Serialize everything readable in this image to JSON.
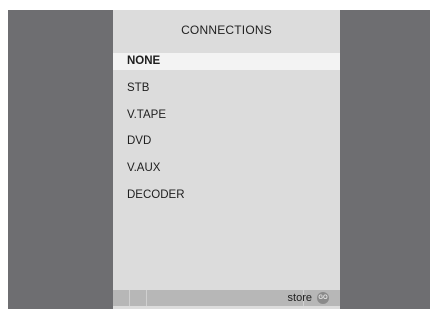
{
  "menu": {
    "title": "CONNECTIONS",
    "items": [
      {
        "label": "NONE",
        "selected": true
      },
      {
        "label": "STB",
        "selected": false
      },
      {
        "label": "V.TAPE",
        "selected": false
      },
      {
        "label": "DVD",
        "selected": false
      },
      {
        "label": "V.AUX",
        "selected": false
      },
      {
        "label": "DECODER",
        "selected": false
      }
    ]
  },
  "statusbar": {
    "store_label": "store",
    "go_label": "GO"
  },
  "colors": {
    "background": "#6e6e71",
    "panel": "#dcdcdc",
    "selected_row": "#f3f3f3",
    "statusbar": "#b7b7b7"
  }
}
